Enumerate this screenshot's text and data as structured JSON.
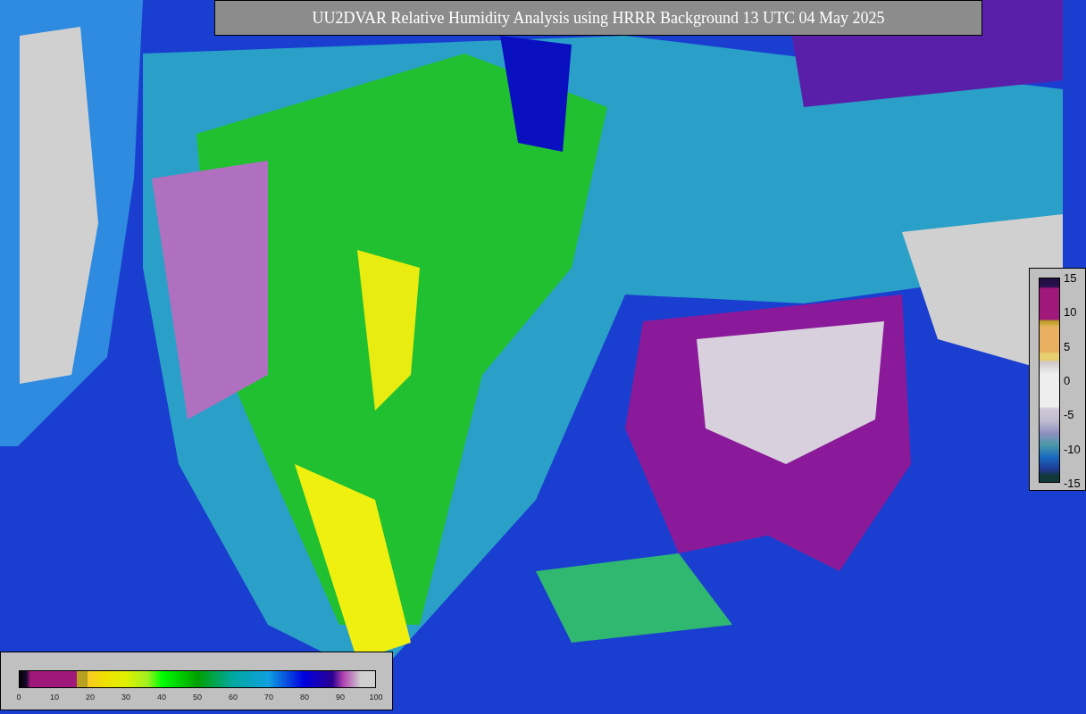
{
  "title": "UU2DVAR Relative Humidity Analysis using HRRR Background 13 UTC 04 May 2025",
  "humidity_scale": {
    "ticks": [
      "0",
      "10",
      "20",
      "30",
      "40",
      "50",
      "60",
      "70",
      "80",
      "90",
      "100"
    ]
  },
  "difference_scale": {
    "ticks": [
      "15",
      "10",
      "5",
      "0",
      "-5",
      "-10",
      "-15"
    ]
  }
}
